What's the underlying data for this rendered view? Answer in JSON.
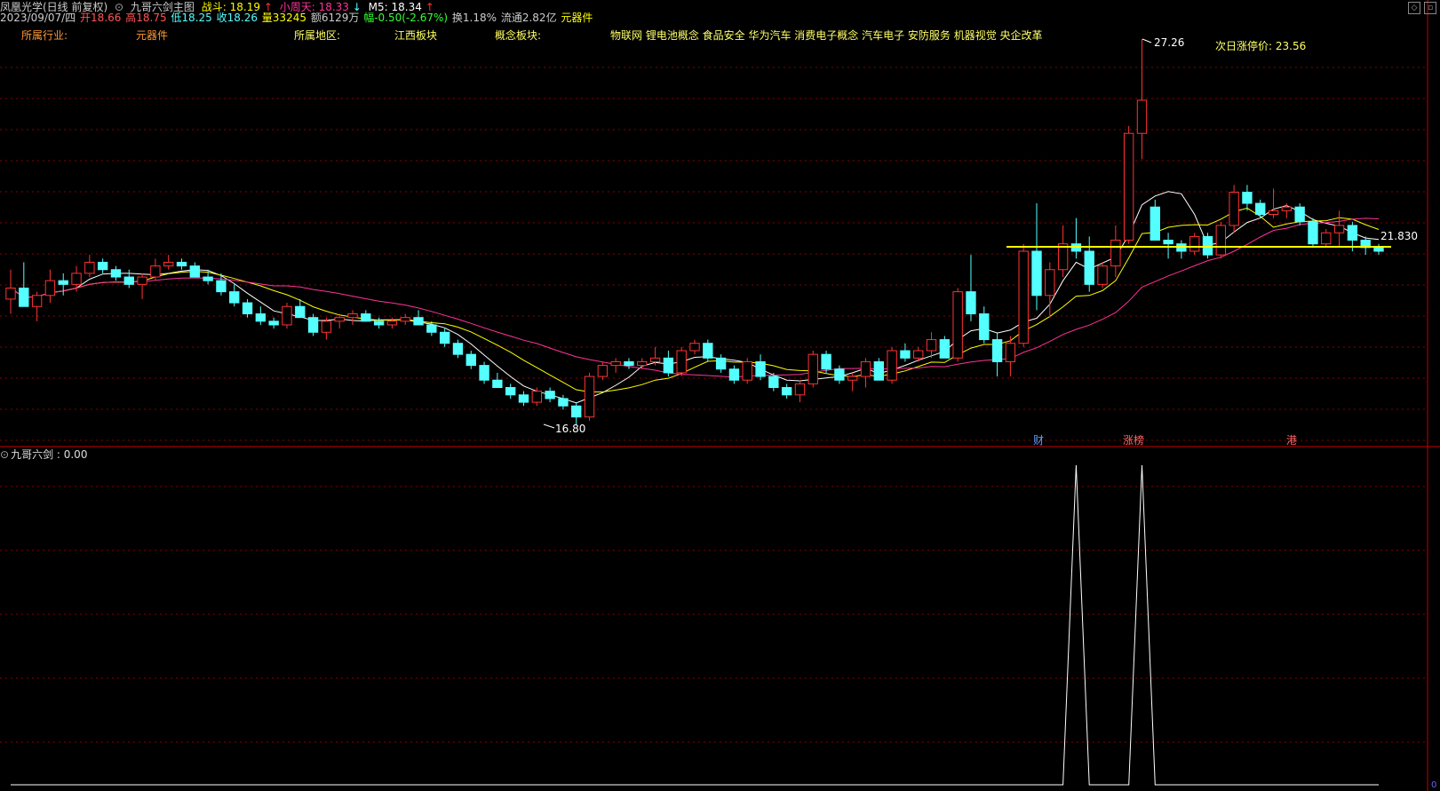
{
  "header": {
    "stock_title": "凤凰光学(日线 前复权)",
    "indicator_title": "九哥六剑主图",
    "zhandou_label": "战斗:",
    "zhandou_value": "18.19",
    "zhandou_arrow": "↑",
    "xiaozhoutian_label": "小周天:",
    "xiaozhoutian_value": "18.33",
    "xiaozhoutian_arrow": "↓",
    "m5_label": "M5:",
    "m5_value": "18.34",
    "m5_arrow": "↑"
  },
  "quote": {
    "date": "2023/09/07/四",
    "open": "开18.66",
    "high": "高18.75",
    "low": "低18.25",
    "close": "收18.26",
    "volume": "量33245",
    "amount": "额6129万",
    "change": "幅-0.50(-2.67%)",
    "turnover": "换1.18%",
    "float_cap": "流通2.82亿",
    "sector": "元器件"
  },
  "info": {
    "industry_label": "所属行业:",
    "industry_value": "元器件",
    "region_label": "所属地区:",
    "region_value": "江西板块",
    "concept_label": "概念板块:",
    "concept_value": "物联网 锂电池概念 食品安全 华为汽车 消费电子概念 汽车电子 安防服务 机器视觉 央企改革",
    "limit_up_label": "次日涨停价: 23.56"
  },
  "annotations": {
    "high_mark": "27.26",
    "low_mark": "16.80",
    "right_price": "21.830",
    "badge_cai": "财",
    "badge_zhangbang": "涨榜",
    "badge_gang": "港"
  },
  "sub_panel": {
    "title": "九哥六剑 : 0.00",
    "axis_zero": "0"
  },
  "colors": {
    "up": "#ff3333",
    "down": "#54ffff",
    "ma5": "#ffffff",
    "ma10": "#ffff00",
    "ma20": "#ff3399",
    "support": "#ffff00",
    "grid": "#8b0000"
  },
  "chart_data": {
    "type": "candlestick",
    "price_range": [
      16.5,
      27.5
    ],
    "candles": [
      [
        20.2,
        21.0,
        19.8,
        20.5
      ],
      [
        20.5,
        21.2,
        20.1,
        20.0
      ],
      [
        20.0,
        20.4,
        19.6,
        20.3
      ],
      [
        20.3,
        21.0,
        20.1,
        20.7
      ],
      [
        20.7,
        20.9,
        20.3,
        20.6
      ],
      [
        20.6,
        21.1,
        20.4,
        20.9
      ],
      [
        20.9,
        21.4,
        20.8,
        21.2
      ],
      [
        21.2,
        21.3,
        20.9,
        21.0
      ],
      [
        21.0,
        21.1,
        20.7,
        20.8
      ],
      [
        20.8,
        21.0,
        20.5,
        20.6
      ],
      [
        20.6,
        20.9,
        20.2,
        20.8
      ],
      [
        20.8,
        21.3,
        20.7,
        21.1
      ],
      [
        21.1,
        21.4,
        21.0,
        21.2
      ],
      [
        21.2,
        21.3,
        21.0,
        21.1
      ],
      [
        21.1,
        21.2,
        20.8,
        20.8
      ],
      [
        20.8,
        21.0,
        20.6,
        20.7
      ],
      [
        20.7,
        20.9,
        20.3,
        20.4
      ],
      [
        20.4,
        20.6,
        20.0,
        20.1
      ],
      [
        20.1,
        20.2,
        19.7,
        19.8
      ],
      [
        19.8,
        20.0,
        19.5,
        19.6
      ],
      [
        19.6,
        19.7,
        19.4,
        19.5
      ],
      [
        19.5,
        20.1,
        19.4,
        20.0
      ],
      [
        20.0,
        20.2,
        19.7,
        19.7
      ],
      [
        19.7,
        19.8,
        19.2,
        19.3
      ],
      [
        19.3,
        19.7,
        19.1,
        19.6
      ],
      [
        19.6,
        19.8,
        19.4,
        19.7
      ],
      [
        19.7,
        19.9,
        19.5,
        19.8
      ],
      [
        19.8,
        19.9,
        19.6,
        19.6
      ],
      [
        19.6,
        19.7,
        19.4,
        19.5
      ],
      [
        19.5,
        19.7,
        19.4,
        19.6
      ],
      [
        19.6,
        19.8,
        19.5,
        19.7
      ],
      [
        19.7,
        19.9,
        19.5,
        19.5
      ],
      [
        19.5,
        19.6,
        19.2,
        19.3
      ],
      [
        19.3,
        19.4,
        18.9,
        19.0
      ],
      [
        19.0,
        19.1,
        18.6,
        18.7
      ],
      [
        18.7,
        18.8,
        18.3,
        18.4
      ],
      [
        18.4,
        18.5,
        17.9,
        18.0
      ],
      [
        18.0,
        18.2,
        17.8,
        17.8
      ],
      [
        17.8,
        17.9,
        17.5,
        17.6
      ],
      [
        17.6,
        17.7,
        17.3,
        17.4
      ],
      [
        17.4,
        17.8,
        17.3,
        17.7
      ],
      [
        17.7,
        17.8,
        17.4,
        17.5
      ],
      [
        17.5,
        17.6,
        17.2,
        17.3
      ],
      [
        17.3,
        17.4,
        16.8,
        17.0
      ],
      [
        17.0,
        18.2,
        16.9,
        18.1
      ],
      [
        18.1,
        18.5,
        18.0,
        18.4
      ],
      [
        18.4,
        18.6,
        18.2,
        18.5
      ],
      [
        18.5,
        18.6,
        18.3,
        18.4
      ],
      [
        18.4,
        18.6,
        18.3,
        18.5
      ],
      [
        18.5,
        18.9,
        18.4,
        18.6
      ],
      [
        18.6,
        18.8,
        18.1,
        18.2
      ],
      [
        18.2,
        18.9,
        18.1,
        18.8
      ],
      [
        18.8,
        19.1,
        18.7,
        19.0
      ],
      [
        19.0,
        19.1,
        18.5,
        18.6
      ],
      [
        18.6,
        18.7,
        18.2,
        18.3
      ],
      [
        18.3,
        18.4,
        17.9,
        18.0
      ],
      [
        18.0,
        18.6,
        17.9,
        18.5
      ],
      [
        18.5,
        18.7,
        18.0,
        18.1
      ],
      [
        18.1,
        18.2,
        17.7,
        17.8
      ],
      [
        17.8,
        17.9,
        17.5,
        17.6
      ],
      [
        17.6,
        18.0,
        17.4,
        17.9
      ],
      [
        17.9,
        18.8,
        17.8,
        18.7
      ],
      [
        18.7,
        18.8,
        18.2,
        18.3
      ],
      [
        18.3,
        18.4,
        17.9,
        18.0
      ],
      [
        18.0,
        18.2,
        17.7,
        18.1
      ],
      [
        18.1,
        18.6,
        17.8,
        18.5
      ],
      [
        18.5,
        18.6,
        18.0,
        18.0
      ],
      [
        18.0,
        18.9,
        17.9,
        18.8
      ],
      [
        18.8,
        19.0,
        18.5,
        18.6
      ],
      [
        18.6,
        18.9,
        18.5,
        18.8
      ],
      [
        18.8,
        19.3,
        18.6,
        19.1
      ],
      [
        19.1,
        19.2,
        18.6,
        18.6
      ],
      [
        18.6,
        20.5,
        18.5,
        20.4
      ],
      [
        20.4,
        21.4,
        19.6,
        19.8
      ],
      [
        19.8,
        20.0,
        19.0,
        19.1
      ],
      [
        19.1,
        19.3,
        18.1,
        18.5
      ],
      [
        18.5,
        19.2,
        18.1,
        19.0
      ],
      [
        19.0,
        21.7,
        18.9,
        21.5
      ],
      [
        21.5,
        22.8,
        19.9,
        20.3
      ],
      [
        20.3,
        21.2,
        19.7,
        21.0
      ],
      [
        21.0,
        22.2,
        20.8,
        21.7
      ],
      [
        21.7,
        22.4,
        21.3,
        21.5
      ],
      [
        21.5,
        21.9,
        20.4,
        20.6
      ],
      [
        20.6,
        21.2,
        20.5,
        21.1
      ],
      [
        21.1,
        22.2,
        20.8,
        21.8
      ],
      [
        21.8,
        24.9,
        21.7,
        24.7
      ],
      [
        24.7,
        27.26,
        24.0,
        25.6
      ],
      [
        22.7,
        22.9,
        22.0,
        21.8
      ],
      [
        21.8,
        22.0,
        21.3,
        21.7
      ],
      [
        21.7,
        21.8,
        21.3,
        21.5
      ],
      [
        21.5,
        22.0,
        21.4,
        21.9
      ],
      [
        21.9,
        22.0,
        21.3,
        21.4
      ],
      [
        21.4,
        22.3,
        21.3,
        22.2
      ],
      [
        22.2,
        23.3,
        22.0,
        23.1
      ],
      [
        23.1,
        23.3,
        22.6,
        22.8
      ],
      [
        22.8,
        22.9,
        22.4,
        22.5
      ],
      [
        22.5,
        23.2,
        22.4,
        22.6
      ],
      [
        22.6,
        22.8,
        22.4,
        22.7
      ],
      [
        22.7,
        22.8,
        22.2,
        22.3
      ],
      [
        22.3,
        22.4,
        21.6,
        21.7
      ],
      [
        21.7,
        22.1,
        21.6,
        22.0
      ],
      [
        22.0,
        22.6,
        21.6,
        22.2
      ],
      [
        22.2,
        22.3,
        21.5,
        21.8
      ],
      [
        21.8,
        21.9,
        21.4,
        21.6
      ],
      [
        21.6,
        21.7,
        21.4,
        21.5
      ]
    ],
    "subchart_values": [
      0,
      0,
      0,
      0,
      0,
      0,
      0,
      0,
      0,
      0,
      0,
      0,
      0,
      0,
      0,
      0,
      0,
      0,
      0,
      0,
      0,
      0,
      0,
      0,
      0,
      0,
      0,
      0,
      0,
      0,
      0,
      0,
      0,
      0,
      0,
      0,
      0,
      0,
      0,
      0,
      0,
      0,
      0,
      0,
      0,
      0,
      0,
      0,
      0,
      0,
      0,
      0,
      0,
      0,
      0,
      0,
      0,
      0,
      0,
      0,
      0,
      0,
      0,
      0,
      0,
      0,
      0,
      0,
      0,
      0,
      0,
      0,
      0,
      0,
      0,
      0,
      0,
      0,
      0,
      0,
      0,
      1,
      0,
      0,
      0,
      0,
      1,
      0,
      0,
      0,
      0,
      0,
      0,
      0,
      0,
      0,
      0,
      0,
      0,
      0,
      0,
      0,
      0,
      0,
      0
    ]
  }
}
